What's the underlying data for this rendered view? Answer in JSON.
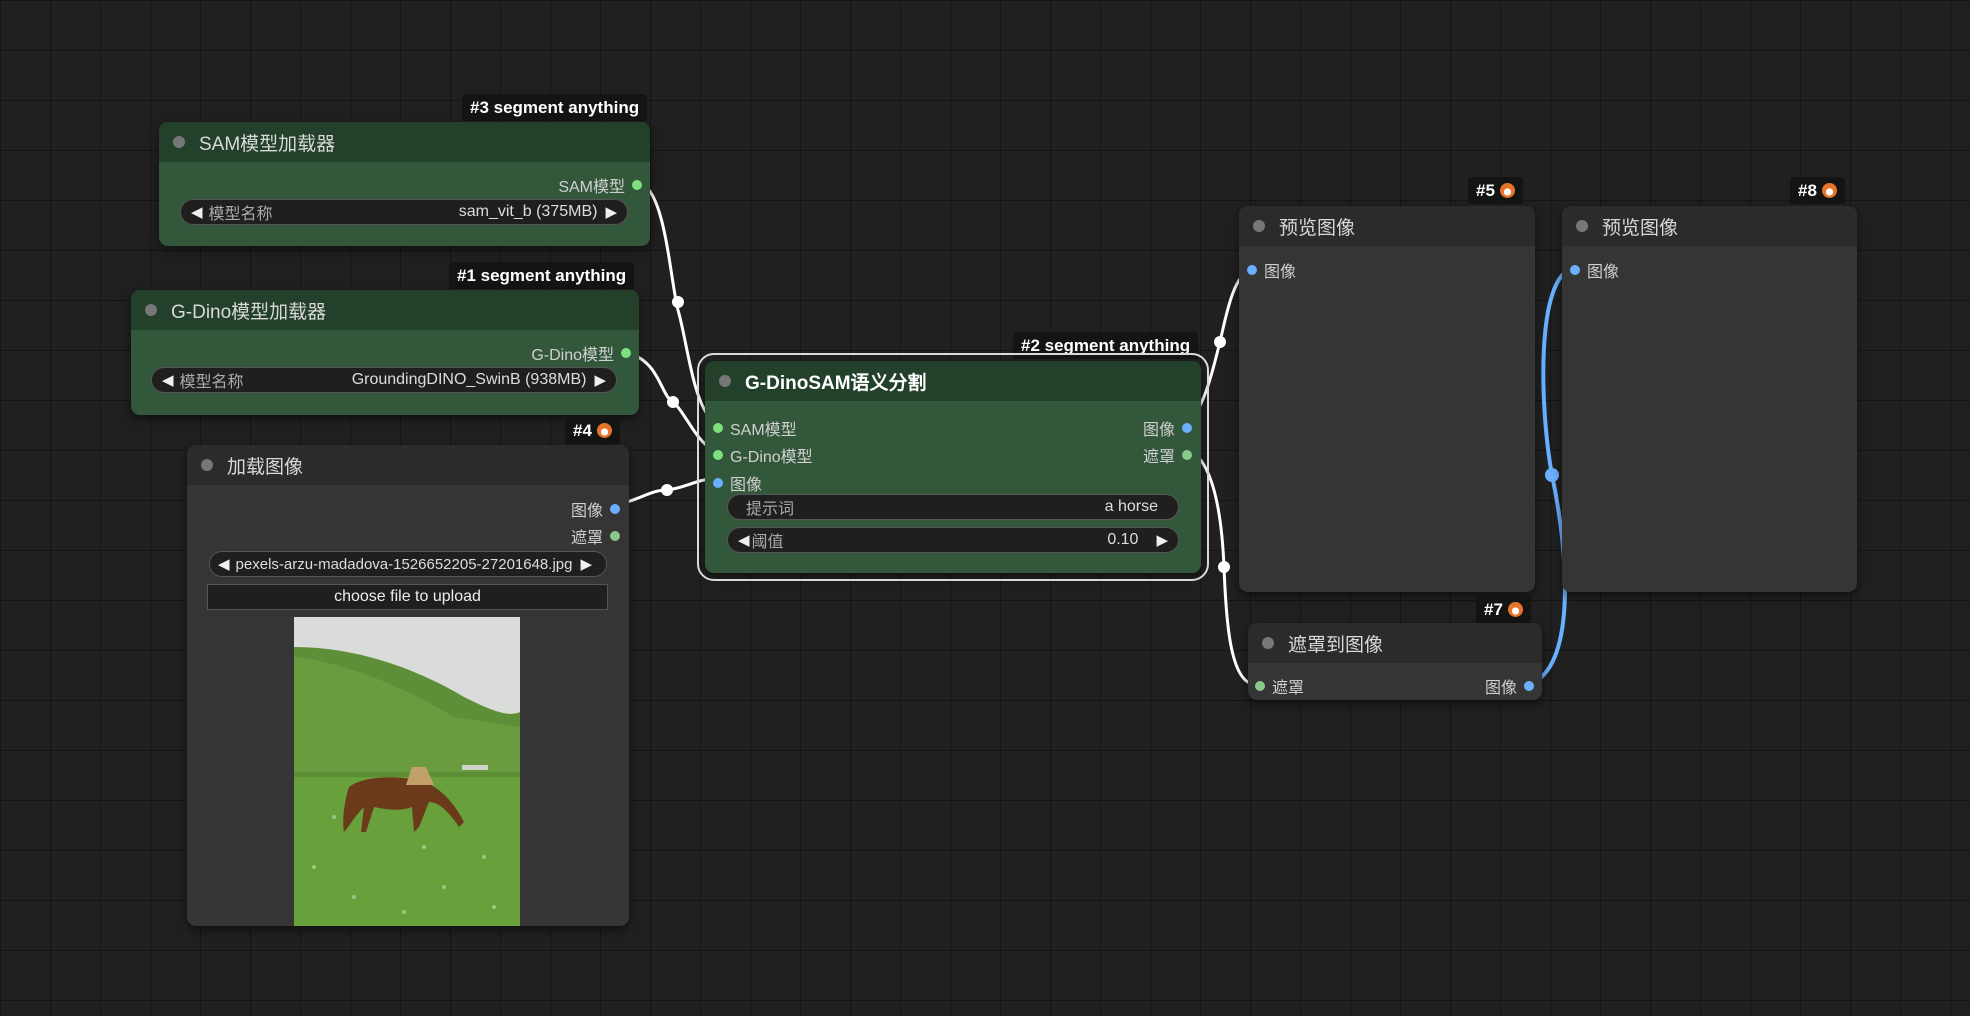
{
  "colors": {
    "canvas_bg": "#202020",
    "green_node": "#33573a",
    "green_node_header": "#23402a",
    "gray_node": "#353535",
    "pin_green": "#7fe07f",
    "pin_blue": "#6ab0ff",
    "wire_white": "#ffffff",
    "wire_blue": "#6ab0ff"
  },
  "nodes": {
    "sam_loader": {
      "badge": "#3 segment anything",
      "title": "SAM模型加载器",
      "output": "SAM模型",
      "widget_label": "模型名称",
      "widget_value": "sam_vit_b (375MB)"
    },
    "gdino_loader": {
      "badge": "#1 segment anything",
      "title": "G-Dino模型加载器",
      "output": "G-Dino模型",
      "widget_label": "模型名称",
      "widget_value": "GroundingDINO_SwinB (938MB)"
    },
    "load_image": {
      "badge": "#4",
      "title": "加载图像",
      "output_image": "图像",
      "output_mask": "遮罩",
      "widget_value": "pexels-arzu-madadova-1526652205-27201648.jpg",
      "upload_label": "choose file to upload",
      "photo_icon": "horse-on-meadow-photo"
    },
    "gdinosam": {
      "badge": "#2 segment anything",
      "title": "G-DinoSAM语义分割",
      "input_sam": "SAM模型",
      "input_gdino": "G-Dino模型",
      "input_image": "图像",
      "output_image": "图像",
      "output_mask": "遮罩",
      "prompt_label": "提示词",
      "prompt_value": "a horse",
      "threshold_label": "阈值",
      "threshold_value": "0.10"
    },
    "preview5": {
      "badge": "#5",
      "title": "预览图像",
      "input": "图像"
    },
    "preview8": {
      "badge": "#8",
      "title": "预览图像",
      "input": "图像"
    },
    "mask_to_image": {
      "badge": "#7",
      "title": "遮罩到图像",
      "input": "遮罩",
      "output": "图像"
    }
  }
}
